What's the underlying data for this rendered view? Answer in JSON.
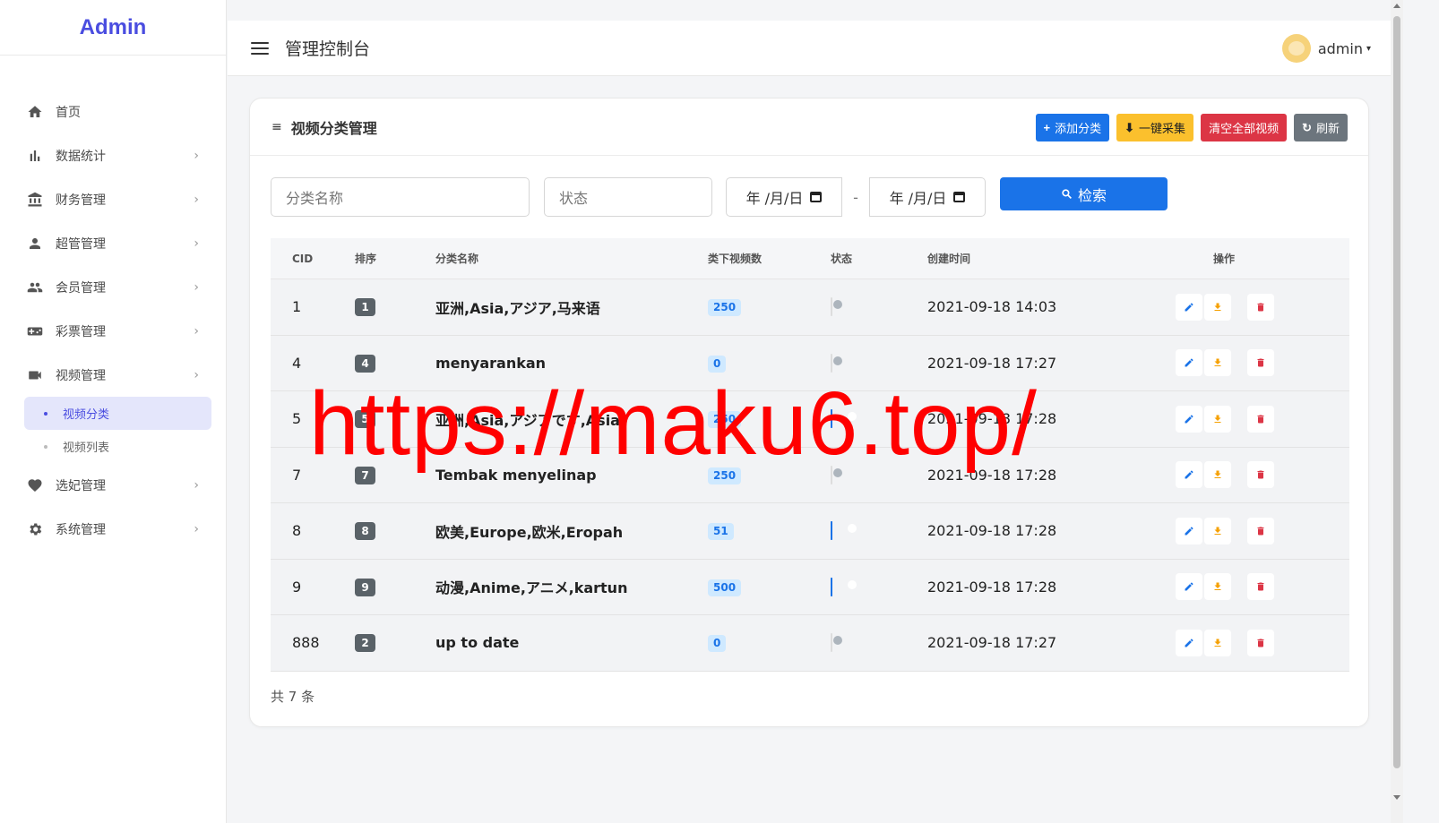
{
  "brand": "Admin",
  "sidebar": {
    "items": [
      {
        "label": "首页",
        "icon": "home-icon"
      },
      {
        "label": "数据统计",
        "icon": "bar-chart-icon"
      },
      {
        "label": "财务管理",
        "icon": "bank-icon"
      },
      {
        "label": "超管管理",
        "icon": "user-icon"
      },
      {
        "label": "会员管理",
        "icon": "users-icon"
      },
      {
        "label": "彩票管理",
        "icon": "gamepad-icon"
      },
      {
        "label": "视频管理",
        "icon": "video-icon"
      }
    ],
    "sub_items": [
      {
        "label": "视频分类",
        "active": true
      },
      {
        "label": "视频列表",
        "active": false
      }
    ],
    "items_after": [
      {
        "label": "选妃管理",
        "icon": "heart-icon"
      },
      {
        "label": "系统管理",
        "icon": "gear-icon"
      }
    ]
  },
  "header": {
    "title": "管理控制台",
    "user": "admin"
  },
  "card": {
    "title": "视频分类管理",
    "buttons": {
      "add": "添加分类",
      "collect": "一键采集",
      "clear": "清空全部视频",
      "refresh": "刷新"
    }
  },
  "filters": {
    "name_placeholder": "分类名称",
    "status_placeholder": "状态",
    "date_start": "年 /月/日",
    "date_sep": "-",
    "date_end": "年 /月/日",
    "search": "检索"
  },
  "table": {
    "columns": [
      "CID",
      "排序",
      "分类名称",
      "类下视频数",
      "状态",
      "创建时间",
      "操作"
    ],
    "rows": [
      {
        "cid": "1",
        "rank": "1",
        "name": "亚洲,Asia,アジア,马来语",
        "count": "250",
        "enabled": false,
        "created": "2021-09-18 14:03"
      },
      {
        "cid": "4",
        "rank": "4",
        "name": "menyarankan",
        "count": "0",
        "enabled": false,
        "created": "2021-09-18 17:27"
      },
      {
        "cid": "5",
        "rank": "5",
        "name": "亚洲,Asia,アジアです,Asia",
        "count": "250",
        "enabled": true,
        "created": "2021-09-18 17:28"
      },
      {
        "cid": "7",
        "rank": "7",
        "name": "Tembak menyelinap",
        "count": "250",
        "enabled": false,
        "created": "2021-09-18 17:28"
      },
      {
        "cid": "8",
        "rank": "8",
        "name": "欧美,Europe,欧米,Eropah",
        "count": "51",
        "enabled": true,
        "created": "2021-09-18 17:28"
      },
      {
        "cid": "9",
        "rank": "9",
        "name": "动漫,Anime,アニメ,kartun",
        "count": "500",
        "enabled": true,
        "created": "2021-09-18 17:28"
      },
      {
        "cid": "888",
        "rank": "2",
        "name": "up to date",
        "count": "0",
        "enabled": false,
        "created": "2021-09-18 17:27"
      }
    ],
    "total": "共 7 条"
  },
  "watermark": "https://maku6.top/",
  "colors": {
    "primary": "#1a73e8",
    "brand": "#4a4de0",
    "warning": "#fbc02d",
    "danger": "#dc3545",
    "secondary": "#6c757d"
  }
}
